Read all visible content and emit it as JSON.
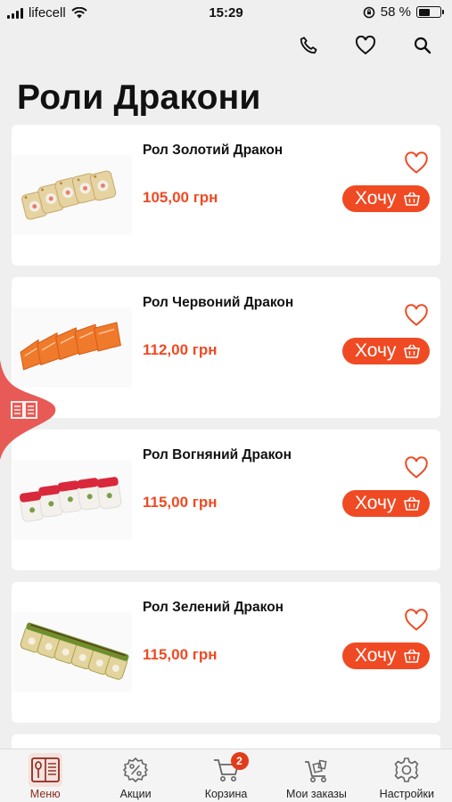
{
  "status_bar": {
    "carrier": "lifecell",
    "time": "15:29",
    "battery": "58 %",
    "battery_level": 0.58
  },
  "page": {
    "title": "Роли Дракони"
  },
  "colors": {
    "accent": "#ef4a23",
    "active_tab": "#8b2a1d",
    "badge": "#e23b1a",
    "side_tab": "#e85a55"
  },
  "actions": {
    "call_icon": "phone-icon",
    "favorites_icon": "heart-icon",
    "search_icon": "search-icon"
  },
  "products": [
    {
      "name": "Рол Золотий Дракон",
      "price": "105,00 грн",
      "button": "Хочу",
      "topping": "golden"
    },
    {
      "name": "Рол Червоний Дракон",
      "price": "112,00 грн",
      "button": "Хочу",
      "topping": "red"
    },
    {
      "name": "Рол Вогняний Дракон",
      "price": "115,00 грн",
      "button": "Хочу",
      "topping": "fire"
    },
    {
      "name": "Рол Зелений Дракон",
      "price": "115,00 грн",
      "button": "Хочу",
      "topping": "green"
    }
  ],
  "tab_bar": {
    "tabs": [
      {
        "label": "Меню",
        "icon": "menu-book-icon",
        "active": true
      },
      {
        "label": "Акции",
        "icon": "discount-icon",
        "active": false
      },
      {
        "label": "Корзина",
        "icon": "cart-icon",
        "active": false,
        "badge": "2"
      },
      {
        "label": "Мои заказы",
        "icon": "orders-cart-icon",
        "active": false
      },
      {
        "label": "Настройки",
        "icon": "gear-icon",
        "active": false
      }
    ]
  }
}
